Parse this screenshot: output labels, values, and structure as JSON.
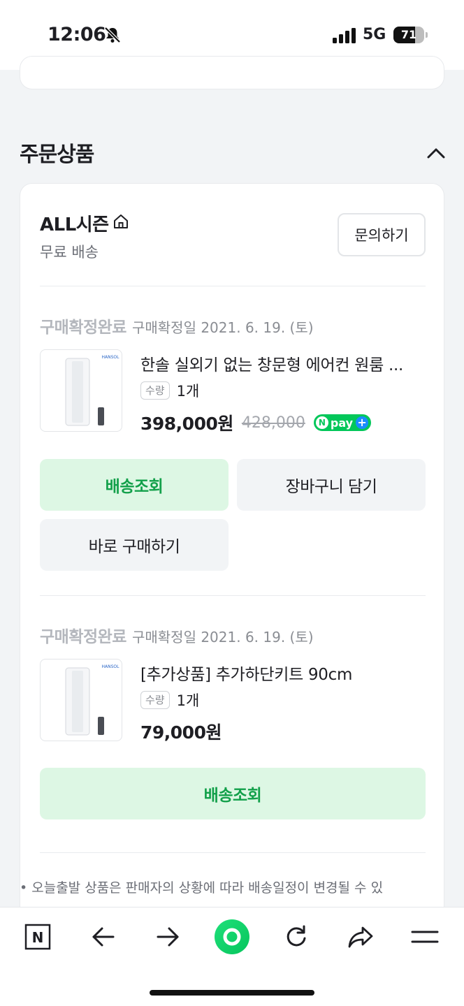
{
  "status_bar": {
    "time": "12:06",
    "network": "5G",
    "battery": "71",
    "battery_level": 0.71
  },
  "section": {
    "title": "주문상품"
  },
  "store": {
    "name": "ALL시즌",
    "shipping": "무료 배송",
    "inquiry_label": "문의하기"
  },
  "orders": [
    {
      "status": "구매확정완료",
      "date_text": "구매확정일 2021. 6. 19. (토)",
      "brand": "HANSOL",
      "name": "한솔 실외기 없는 창문형 에어컨 원룸 ...",
      "qty_label": "수량",
      "qty": "1개",
      "price": "398,000원",
      "original_price": "428,000",
      "npay": {
        "n": "N",
        "text": "pay",
        "plus": "+"
      },
      "buttons": {
        "track": "배송조회",
        "cart": "장바구니 담기",
        "buy_now": "바로 구매하기"
      }
    },
    {
      "status": "구매확정완료",
      "date_text": "구매확정일 2021. 6. 19. (토)",
      "brand": "HANSOL",
      "name": "[추가상품] 추가하단키트 90cm",
      "qty_label": "수량",
      "qty": "1개",
      "price": "79,000원",
      "buttons": {
        "track": "배송조회"
      }
    }
  ],
  "notice": "• 오늘출발 상품은 판매자의 상황에 따라 배송일정이 변경될 수 있",
  "bottom_nav": {
    "logo_letter": "N",
    "items": [
      "naver-home-icon",
      "back-arrow-icon",
      "forward-arrow-icon",
      "green-dot-icon",
      "refresh-icon",
      "share-icon",
      "menu-icon"
    ]
  },
  "colors": {
    "accent_green": "#03c75a",
    "track_button_bg": "#ddf7e4",
    "track_button_text": "#12a04a"
  }
}
